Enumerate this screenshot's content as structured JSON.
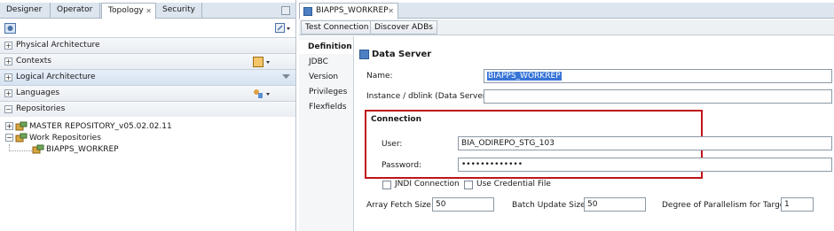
{
  "left_panel": {
    "tabs": [
      "Designer",
      "Operator",
      "Topology",
      "Security"
    ],
    "active_tab": "Topology",
    "accordions": [
      "Physical Architecture",
      "Contexts",
      "Logical Architecture",
      "Languages",
      "Repositories"
    ],
    "tree": {
      "master": "MASTER REPOSITORY_v05.02.02.11",
      "work_group": "Work Repositories",
      "work_repo": "BIAPPS_WORKREP"
    }
  },
  "editor": {
    "tab_title": "BIAPPS_WORKREP",
    "buttons": [
      "Test Connection",
      "Discover ADBs"
    ],
    "nav": [
      "Definition",
      "JDBC",
      "Version",
      "Privileges",
      "Flexfields"
    ],
    "active_nav": "Definition",
    "section_title": "Data Server",
    "name_label": "Name:",
    "name_value": "BIAPPS_WORKREP",
    "instance_label": "Instance / dblink (Data Server):",
    "instance_value": "",
    "connection_title": "Connection",
    "user_label": "User:",
    "user_value": "BIA_ODIREPO_STG_103",
    "password_label": "Password:",
    "password_value": "•••••••••••••",
    "jndi_label": "JNDI Connection",
    "credential_label": "Use Credential File",
    "array_fetch_label": "Array Fetch Size:",
    "array_fetch_value": "50",
    "batch_update_label": "Batch Update Size:",
    "batch_update_value": "50",
    "parallel_label": "Degree of Parallelism for Target:",
    "parallel_value": "1"
  },
  "colors": {
    "highlight_box": "#c0141b",
    "selection": "#3875d7",
    "tab_bar": "#dde5ee"
  }
}
